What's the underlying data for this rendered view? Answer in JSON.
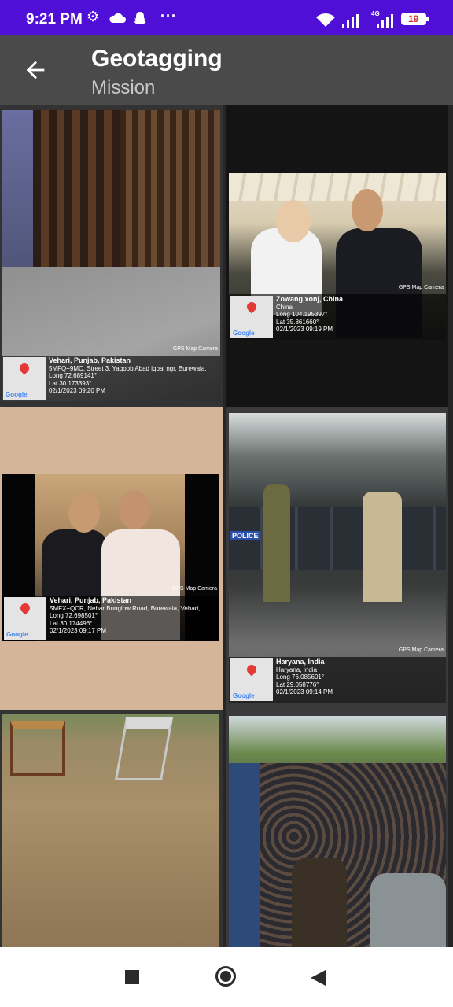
{
  "status_bar": {
    "time": "9:21 PM",
    "battery": "19",
    "network": "4G",
    "more": "···"
  },
  "app_bar": {
    "title": "Geotagging",
    "subtitle": "Mission"
  },
  "photos": [
    {
      "location": "Vehari, Punjab, Pakistan",
      "line1": "5MFQ+9MC, Street 3, Yaqoob Abad iqbal ngr, Burewala,",
      "line2": "Long 72.689141°",
      "line3": "Lat 30.173393°",
      "datetime": "02/1/2023 09:20 PM",
      "camera": "GPS Map Camera",
      "map_label": "Google"
    },
    {
      "location": "Zowang,xonj, China",
      "line1": "China",
      "line2": "Long 104.195397°",
      "line3": "Lat 35.861660°",
      "datetime": "02/1/2023 09:19 PM",
      "camera": "GPS Map Camera",
      "map_label": "Google"
    },
    {
      "location": "Vehari, Punjab, Pakistan",
      "line1": "5MFX+QCR, Nehar Bunglow Road, Burewala, Vehari,",
      "line2": "Long 72.698501°",
      "line3": "Lat 30.174496°",
      "datetime": "02/1/2023 09:17 PM",
      "camera": "GPS Map Camera",
      "map_label": "Google"
    },
    {
      "location": "Haryana, India",
      "line1": "Haryana, India",
      "line2": "Long 76.085601°",
      "line3": "Lat 29.058776°",
      "datetime": "02/1/2023 09:14 PM",
      "camera": "GPS Map Camera",
      "map_label": "Google"
    },
    {
      "location": "",
      "line1": "",
      "line2": "",
      "line3": "",
      "datetime": "",
      "camera": "",
      "map_label": ""
    },
    {
      "location": "",
      "line1": "",
      "line2": "",
      "line3": "",
      "datetime": "",
      "camera": "",
      "map_label": ""
    }
  ],
  "police_text": "POLICE",
  "icons": {
    "back": "arrow-back-icon",
    "nav_recent": "square-icon",
    "nav_home": "circle-icon",
    "nav_back": "triangle-back-icon"
  },
  "colors": {
    "status_bar": "#4f0fd6",
    "app_bar": "#4a4a4a",
    "pin": "#e53935"
  }
}
